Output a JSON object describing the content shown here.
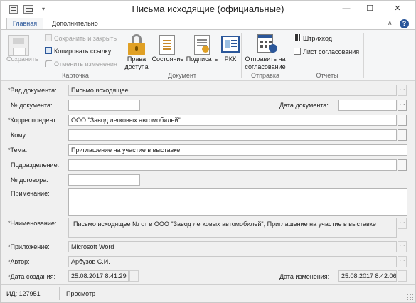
{
  "window": {
    "title": "Письма исходящие (официальные)",
    "quick_access_more": "▾",
    "controls": {
      "minimize": "—",
      "maximize": "☐",
      "close": "✕"
    }
  },
  "tabs": {
    "home": "Главная",
    "extra": "Дополнительно",
    "collapse": "∧",
    "help": "?"
  },
  "ribbon": {
    "card": {
      "label": "Карточка",
      "save": "Сохранить",
      "save_close": "Сохранить и закрыть",
      "copy_link": "Копировать ссылку",
      "cancel_changes": "Отменить изменения"
    },
    "document": {
      "label": "Документ",
      "access_rights_1": "Права",
      "access_rights_2": "доступа",
      "state": "Состояние",
      "sign": "Подписать",
      "rkk": "РКК"
    },
    "sending": {
      "label": "Отправка",
      "send_1": "Отправить на",
      "send_2": "согласование"
    },
    "reports": {
      "label": "Отчеты",
      "barcode": "Штрихкод",
      "approval_sheet": "Лист согласования"
    }
  },
  "form": {
    "ellipsis": "···",
    "doc_type_label": "*Вид документа:",
    "doc_type_value": "Письмо исходящее",
    "doc_number_label": "№ документа:",
    "doc_number_value": "",
    "doc_date_label": "Дата документа:",
    "doc_date_value": "",
    "correspondent_label": "*Корреспондент:",
    "correspondent_value": "ООО \"Завод легковых автомобилей\"",
    "to_whom_label": "Кому:",
    "to_whom_value": "",
    "subject_label": "*Тема:",
    "subject_value": "Приглашение на участие в выставке",
    "department_label": "Подразделение:",
    "department_value": "",
    "contract_label": "№ договора:",
    "contract_value": "",
    "note_label": "Примечание:",
    "note_value": "",
    "name_label": "*Наименование:",
    "name_value": "Письмо исходящее №  от  в ООО \"Завод легковых автомобилей\",  Приглашение на участие в выставке",
    "attachment_label": "*Приложение:",
    "attachment_value": "Microsoft Word",
    "author_label": "*Автор:",
    "author_value": "Арбузов С.И.",
    "created_label": "*Дата создания:",
    "created_value": "25.08.2017 8:41:29",
    "modified_label": "Дата изменения:",
    "modified_value": "25.08.2017 8:42:06"
  },
  "status": {
    "id": "ИД: 127951",
    "mode": "Просмотр"
  },
  "colors": {
    "accent": "#2b579a",
    "lock": "#e0a025",
    "form_bg": "#f0f0f0"
  }
}
